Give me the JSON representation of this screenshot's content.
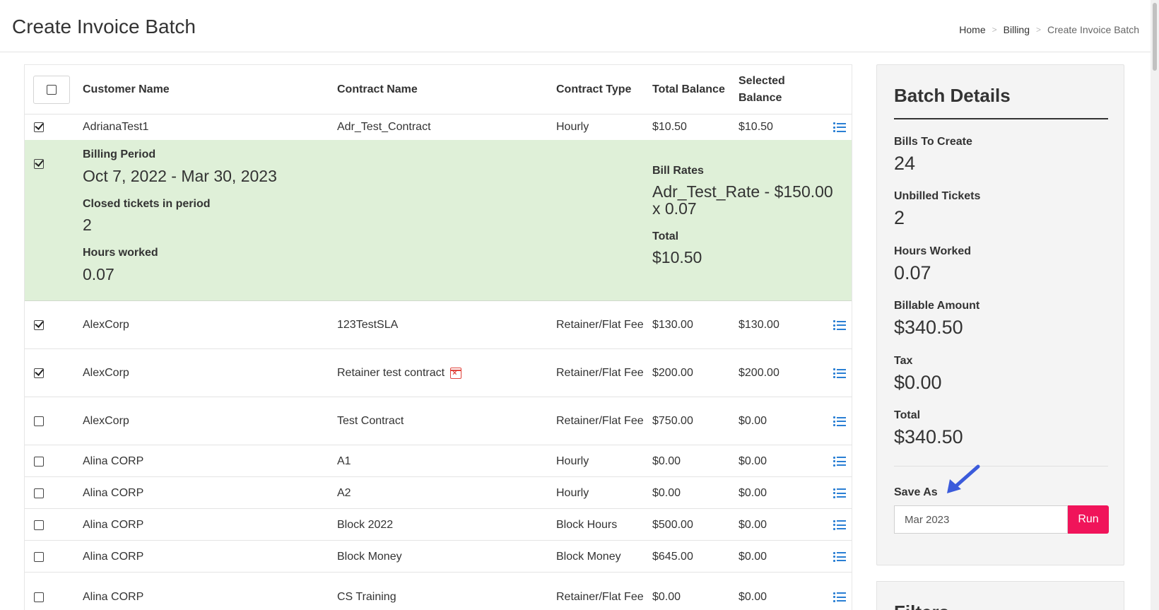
{
  "header": {
    "title": "Create Invoice Batch",
    "breadcrumb": [
      "Home",
      "Billing",
      "Create Invoice Batch"
    ],
    "breadcrumb_sep": ">"
  },
  "table": {
    "columns": [
      "Customer Name",
      "Contract Name",
      "Contract Type",
      "Total Balance",
      "Selected Balance"
    ],
    "rows": [
      {
        "checked": true,
        "customer": "AdrianaTest1",
        "contract": "Adr_Test_Contract",
        "type": "Hourly",
        "total": "$10.50",
        "selected": "$10.50",
        "expanded": true
      },
      {
        "checked": true,
        "customer": "AlexCorp",
        "contract": "123TestSLA",
        "type": "Retainer/Flat Fee",
        "total": "$130.00",
        "selected": "$130.00"
      },
      {
        "checked": true,
        "customer": "AlexCorp",
        "contract": "Retainer test contract",
        "type": "Retainer/Flat Fee",
        "total": "$200.00",
        "selected": "$200.00",
        "icon": "calendar-x-icon"
      },
      {
        "checked": false,
        "customer": "AlexCorp",
        "contract": "Test Contract",
        "type": "Retainer/Flat Fee",
        "total": "$750.00",
        "selected": "$0.00"
      },
      {
        "checked": false,
        "customer": "Alina CORP",
        "contract": "A1",
        "type": "Hourly",
        "total": "$0.00",
        "selected": "$0.00"
      },
      {
        "checked": false,
        "customer": "Alina CORP",
        "contract": "A2",
        "type": "Hourly",
        "total": "$0.00",
        "selected": "$0.00"
      },
      {
        "checked": false,
        "customer": "Alina CORP",
        "contract": "Block 2022",
        "type": "Block Hours",
        "total": "$500.00",
        "selected": "$0.00"
      },
      {
        "checked": false,
        "customer": "Alina CORP",
        "contract": "Block Money",
        "type": "Block Money",
        "total": "$645.00",
        "selected": "$0.00"
      },
      {
        "checked": false,
        "customer": "Alina CORP",
        "contract": "CS Training",
        "type": "Retainer/Flat Fee",
        "total": "$0.00",
        "selected": "$0.00"
      }
    ],
    "detail": {
      "billing_period_label": "Billing Period",
      "billing_period_value": "Oct 7, 2022 - Mar 30, 2023",
      "closed_tickets_label": "Closed tickets in period",
      "closed_tickets_value": "2",
      "hours_worked_label": "Hours worked",
      "hours_worked_value": "0.07",
      "bill_rates_label": "Bill Rates",
      "bill_rates_value": "Adr_Test_Rate - $150.00 x 0.07",
      "total_label": "Total",
      "total_value": "$10.50"
    }
  },
  "batch": {
    "title": "Batch Details",
    "stats": [
      {
        "label": "Bills To Create",
        "value": "24"
      },
      {
        "label": "Unbilled Tickets",
        "value": "2"
      },
      {
        "label": "Hours Worked",
        "value": "0.07"
      },
      {
        "label": "Billable Amount",
        "value": "$340.50"
      },
      {
        "label": "Tax",
        "value": "$0.00"
      },
      {
        "label": "Total",
        "value": "$340.50"
      }
    ],
    "save_as_label": "Save As",
    "save_as_value": "Mar 2023",
    "run_label": "Run"
  },
  "filters": {
    "title": "Filters"
  },
  "colors": {
    "accent": "#f0145a",
    "link_icon": "#2a7fd4",
    "expanded_bg": "#dff0d8",
    "arrow": "#3b5bdb"
  }
}
